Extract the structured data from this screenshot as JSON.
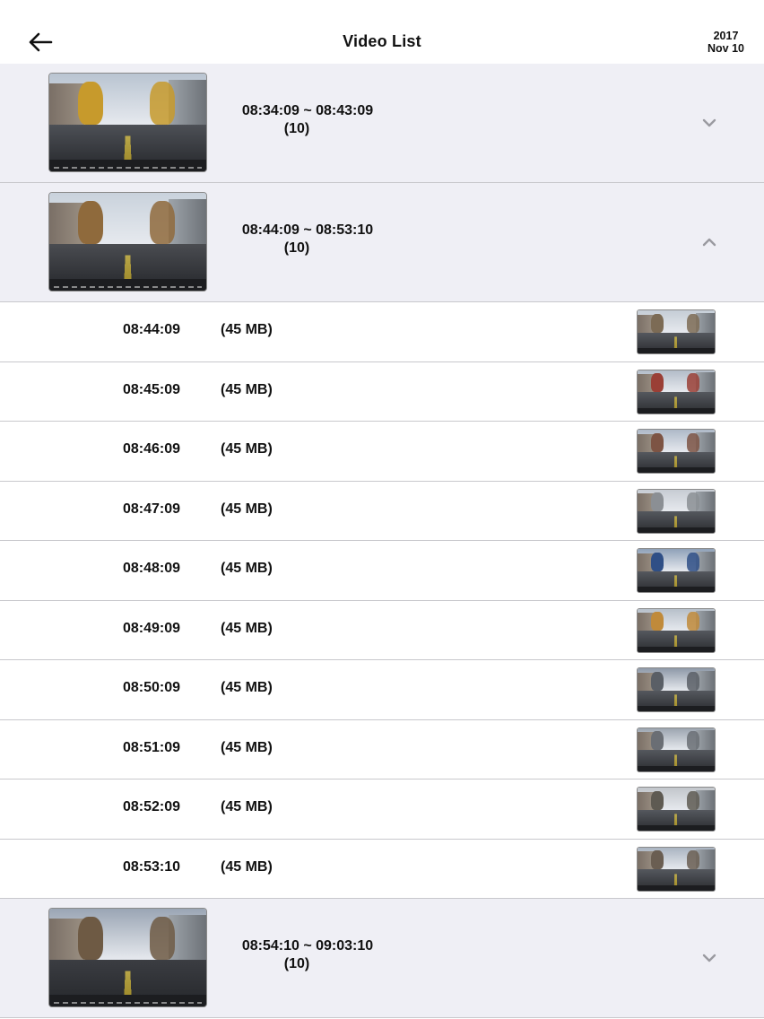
{
  "header": {
    "title": "Video List",
    "date_year": "2017",
    "date_day": "Nov 10"
  },
  "groups": [
    {
      "range": "08:34:09 ~ 08:43:09",
      "count": "(10)",
      "expanded": false,
      "thumb": {
        "sky": "#b9c4d1",
        "tree": "#c79a2c",
        "ground": "#4d5056"
      }
    },
    {
      "range": "08:44:09 ~ 08:53:10",
      "count": "(10)",
      "expanded": true,
      "thumb": {
        "sky": "#c9d2dc",
        "tree": "#8f6a3c",
        "ground": "#4a4c51"
      }
    },
    {
      "range": "08:54:10 ~ 09:03:10",
      "count": "(10)",
      "expanded": false,
      "thumb": {
        "sky": "#9aa5b4",
        "tree": "#6e5a44",
        "ground": "#3b3d42"
      }
    }
  ],
  "items": [
    {
      "time": "08:44:09",
      "size": "(45 MB)",
      "thumb": {
        "sky": "#c5cdd6",
        "tree": "#7c6b55"
      }
    },
    {
      "time": "08:45:09",
      "size": "(45 MB)",
      "thumb": {
        "sky": "#b3bcc8",
        "tree": "#9a3f36"
      }
    },
    {
      "time": "08:46:09",
      "size": "(45 MB)",
      "thumb": {
        "sky": "#aeb9c8",
        "tree": "#7d5444"
      }
    },
    {
      "time": "08:47:09",
      "size": "(45 MB)",
      "thumb": {
        "sky": "#c7ccd3",
        "tree": "#8b8f94"
      }
    },
    {
      "time": "08:48:09",
      "size": "(45 MB)",
      "thumb": {
        "sky": "#8fa1b8",
        "tree": "#2f4f86"
      }
    },
    {
      "time": "08:49:09",
      "size": "(45 MB)",
      "thumb": {
        "sky": "#b7c0ca",
        "tree": "#c08a3a"
      }
    },
    {
      "time": "08:50:09",
      "size": "(45 MB)",
      "thumb": {
        "sky": "#8e99a8",
        "tree": "#5a5f66"
      }
    },
    {
      "time": "08:51:09",
      "size": "(45 MB)",
      "thumb": {
        "sky": "#9ca5b0",
        "tree": "#6a6e74"
      }
    },
    {
      "time": "08:52:09",
      "size": "(45 MB)",
      "thumb": {
        "sky": "#c2c6cb",
        "tree": "#5e5a52"
      }
    },
    {
      "time": "08:53:10",
      "size": "(45 MB)",
      "thumb": {
        "sky": "#aab4c1",
        "tree": "#6a5e52"
      }
    }
  ],
  "icons": {
    "back": "back-arrow-icon",
    "collapsed": "chevron-down-icon",
    "expanded": "chevron-up-icon"
  },
  "colors": {
    "group_bg": "#efeff5",
    "divider": "#c8c8cc",
    "text": "#111111",
    "chevron": "#9a9aa0"
  }
}
